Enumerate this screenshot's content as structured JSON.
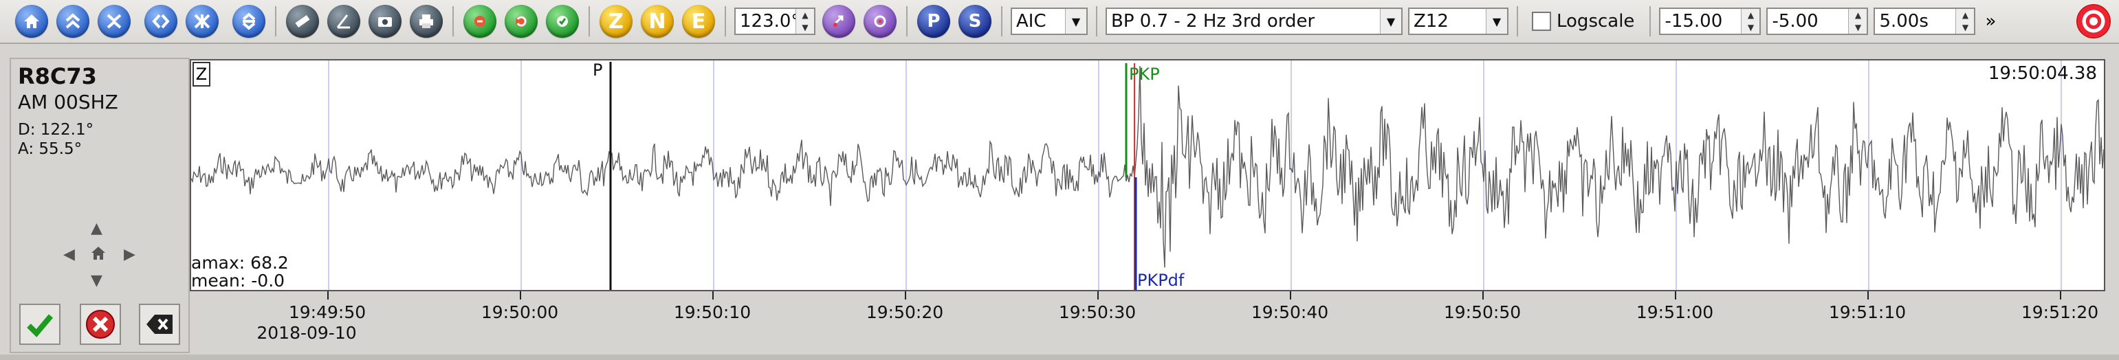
{
  "toolbar": {
    "icons": [
      "home-icon",
      "expand-up-icon",
      "collapse-icon",
      "fit-left-right-icon",
      "skip-end-icon",
      "align-icon",
      "ruler-icon",
      "angle-icon",
      "camera-icon",
      "print-icon",
      "pick-p-icon",
      "pick-s-icon",
      "pick-apply-icon"
    ],
    "components": [
      "Z",
      "N",
      "E"
    ],
    "azimuth": "123.0°",
    "phase_buttons": [
      "P",
      "S"
    ],
    "picker_method": "AIC",
    "filter": "BP 0.7 - 2 Hz  3rd order",
    "channel_select": "Z12",
    "logscale_label": "Logscale",
    "logscale_checked": false,
    "time_min": "-15.00",
    "time_max": "-5.00",
    "window_length": "5.00s",
    "more": "»"
  },
  "station": {
    "code": "R8C73",
    "channel": "AM  00SHZ",
    "distance": "D: 122.1°",
    "azimuth": "A:  55.5°"
  },
  "trace": {
    "component": "Z",
    "clock": "19:50:04.38",
    "amax": "amax: 68.2",
    "mean": "mean: -0.0",
    "picks": [
      {
        "label": "P",
        "color": "#111111"
      },
      {
        "label": "PKP",
        "color": "#1a8c1a"
      },
      {
        "label": "PKPdf",
        "color": "#1b2aa8"
      }
    ],
    "colors": {
      "trace": "#5a5a5a",
      "gridline": "#b7bff0",
      "p_pick": "#111111",
      "pkp_pick": "#1a8c1a",
      "pkpdf_pick": "#1b2aa8",
      "red_marker": "#e03030"
    }
  },
  "axis": {
    "ticks": [
      "19:49:50",
      "19:50:00",
      "19:50:10",
      "19:50:20",
      "19:50:30",
      "19:50:40",
      "19:50:50",
      "19:51:00",
      "19:51:10",
      "19:51:20"
    ],
    "date": "2018-09-10"
  }
}
